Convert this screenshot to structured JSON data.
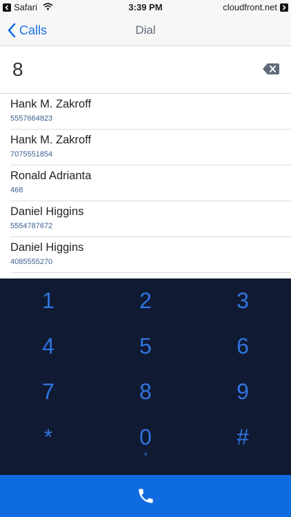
{
  "status_bar": {
    "back_app": "Safari",
    "time": "3:39 PM",
    "site": "cloudfront.net"
  },
  "nav": {
    "back_label": "Calls",
    "title": "Dial"
  },
  "dial": {
    "entered": "8"
  },
  "results": [
    {
      "name": "Hank M. Zakroff",
      "number": "5557664823"
    },
    {
      "name": "Hank M. Zakroff",
      "number": "7075551854"
    },
    {
      "name": "Ronald Adrianta",
      "number": "468"
    },
    {
      "name": "Daniel Higgins",
      "number": "5554787672"
    },
    {
      "name": "Daniel Higgins",
      "number": "4085555270"
    }
  ],
  "keypad": {
    "keys": [
      {
        "digit": "1",
        "sub": ""
      },
      {
        "digit": "2",
        "sub": ""
      },
      {
        "digit": "3",
        "sub": ""
      },
      {
        "digit": "4",
        "sub": ""
      },
      {
        "digit": "5",
        "sub": ""
      },
      {
        "digit": "6",
        "sub": ""
      },
      {
        "digit": "7",
        "sub": ""
      },
      {
        "digit": "8",
        "sub": ""
      },
      {
        "digit": "9",
        "sub": ""
      },
      {
        "digit": "*",
        "sub": ""
      },
      {
        "digit": "0",
        "sub": "+"
      },
      {
        "digit": "#",
        "sub": ""
      }
    ]
  },
  "colors": {
    "accent": "#1a6ee6",
    "keypad_bg": "#111a33",
    "keypad_digit": "#2f74e0",
    "call_bar": "#0f6ce0"
  },
  "icons": {
    "back": "chevron-left-icon",
    "backspace": "backspace-icon",
    "call": "phone-icon"
  }
}
